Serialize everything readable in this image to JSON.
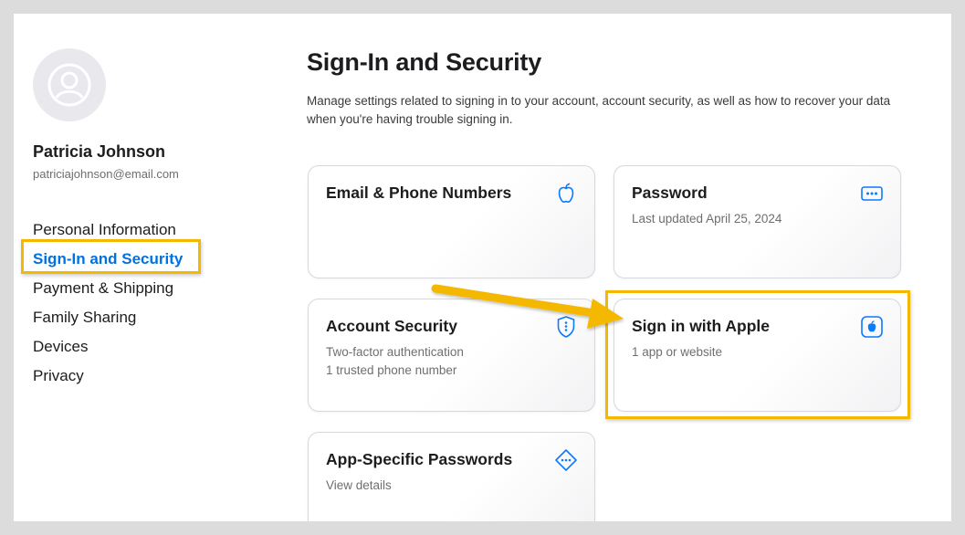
{
  "user": {
    "name": "Patricia Johnson",
    "email": "patriciajohnson@email.com",
    "avatar_icon": "person-circle-icon"
  },
  "sidebar": {
    "items": [
      {
        "label": "Personal Information",
        "active": false
      },
      {
        "label": "Sign-In and Security",
        "active": true
      },
      {
        "label": "Payment & Shipping",
        "active": false
      },
      {
        "label": "Family Sharing",
        "active": false
      },
      {
        "label": "Devices",
        "active": false
      },
      {
        "label": "Privacy",
        "active": false
      }
    ]
  },
  "main": {
    "title": "Sign-In and Security",
    "description": "Manage settings related to signing in to your account, account security, as well as how to recover your data when you're having trouble signing in.",
    "cards": [
      {
        "title": "Email & Phone Numbers",
        "lines": [],
        "icon": "apple-logo-icon"
      },
      {
        "title": "Password",
        "lines": [
          "Last updated April 25, 2024"
        ],
        "icon": "password-dots-icon"
      },
      {
        "title": "Account Security",
        "lines": [
          "Two-factor authentication",
          "1 trusted phone number"
        ],
        "icon": "shield-icon"
      },
      {
        "title": "Sign in with Apple",
        "lines": [
          "1 app or website"
        ],
        "icon": "apple-square-icon"
      },
      {
        "title": "App-Specific Passwords",
        "lines": [
          "View details"
        ],
        "icon": "diamond-dots-icon"
      }
    ]
  },
  "colors": {
    "accent": "#0071e3",
    "highlight": "#f5b800",
    "icon_blue": "#0a7aff"
  }
}
